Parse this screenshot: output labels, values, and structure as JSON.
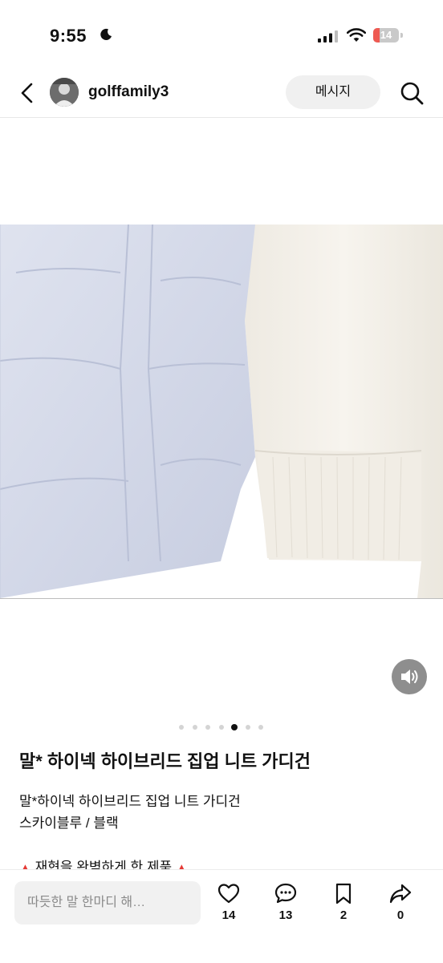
{
  "status_bar": {
    "time": "9:55",
    "battery": "14"
  },
  "header": {
    "username": "golffamily3",
    "message_button": "메시지"
  },
  "product": {
    "title": "말* 하이넥 하이브리드 집업 니트 가디건",
    "description_line1": "말*하이넥 하이브리드 집업 니트 가디건",
    "description_line2": "스카이블루 / 블랙",
    "notice_text": "재현을 완벽하게 한 제품",
    "notice_marker": "▲"
  },
  "carousel": {
    "dot_count": 7,
    "active_index": 4
  },
  "bottom_bar": {
    "comment_placeholder": "따듯한 말 한마디 해…",
    "likes": "14",
    "comments": "13",
    "bookmarks": "2",
    "shares": "0"
  },
  "colors": {
    "accent": "#111111",
    "notice_marker": "#e53935",
    "muted": "#8a8a8a"
  },
  "icons": [
    "moon-icon",
    "signal-icon",
    "wifi-icon",
    "battery-icon",
    "back-icon",
    "search-icon",
    "sound-icon",
    "heart-icon",
    "comment-icon",
    "bookmark-icon",
    "share-icon"
  ]
}
